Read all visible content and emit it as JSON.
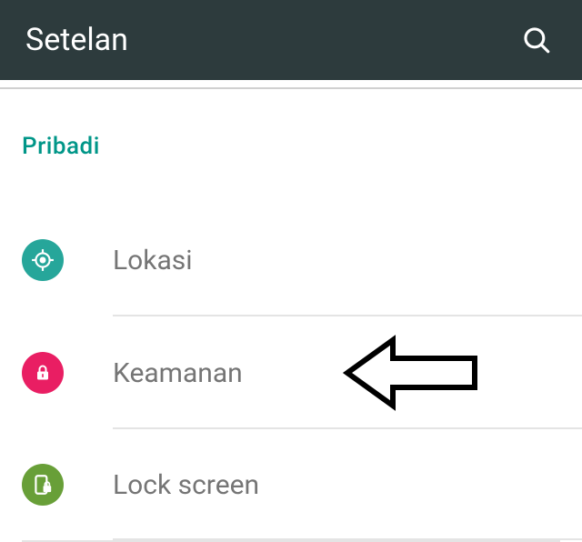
{
  "appbar": {
    "title": "Setelan"
  },
  "section": {
    "header": "Pribadi",
    "items": [
      {
        "label": "Lokasi"
      },
      {
        "label": "Keamanan"
      },
      {
        "label": "Lock screen"
      }
    ]
  }
}
